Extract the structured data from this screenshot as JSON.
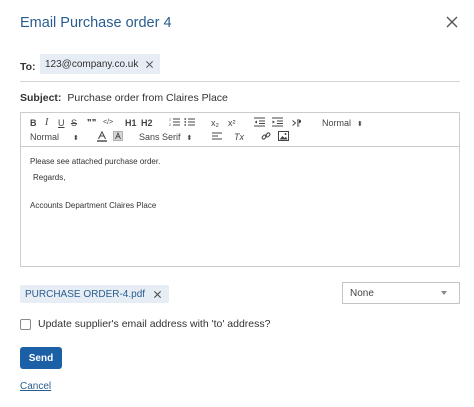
{
  "dialog": {
    "title": "Email Purchase order 4"
  },
  "to": {
    "label": "To:",
    "recipient": "123@company.co.uk"
  },
  "subject": {
    "label": "Subject:",
    "value": "Purchase order from Claires Place"
  },
  "toolbar": {
    "bold": "B",
    "italic": "I",
    "underline": "U",
    "strike": "S",
    "quote": "❞❞",
    "code": "</>",
    "h1": "H1",
    "h2": "H2",
    "subscript": "x₂",
    "superscript": "x²",
    "rtl": "⁋",
    "size_value": "Normal",
    "header_value": "Normal",
    "font_value": "Sans Serif",
    "clean": "Tx"
  },
  "body": {
    "line1": "Please see attached purchase order.",
    "line2": "Regards,",
    "line3": "Accounts Department Claires Place"
  },
  "attachment": {
    "name": "PURCHASE ORDER-4.pdf"
  },
  "template_select": {
    "value": "None"
  },
  "checkbox": {
    "label": "Update supplier's email address with 'to' address?"
  },
  "actions": {
    "send": "Send",
    "cancel": "Cancel"
  }
}
